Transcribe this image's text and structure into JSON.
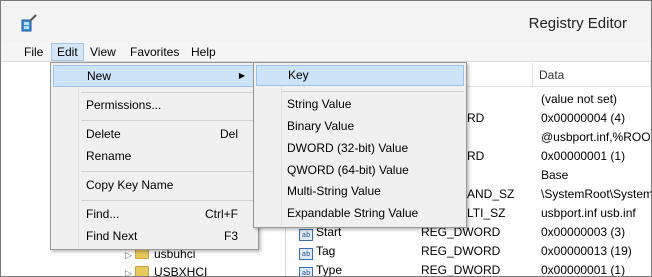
{
  "window": {
    "title": "Registry Editor"
  },
  "menubar": {
    "items": [
      "File",
      "Edit",
      "View",
      "Favorites",
      "Help"
    ]
  },
  "list": {
    "header_data": "Data",
    "rows": [
      {
        "name": "",
        "type": "",
        "data": "(value not set)"
      },
      {
        "name": "",
        "type": "RD",
        "data": "0x00000004 (4)"
      },
      {
        "name": "",
        "type": "",
        "data": "@usbport.inf,%ROOT"
      },
      {
        "name": "",
        "type": "RD",
        "data": "0x00000001 (1)"
      },
      {
        "name": "",
        "type": "",
        "data": "Base"
      },
      {
        "name": "",
        "type": "AND_SZ",
        "data": "\\SystemRoot\\System"
      },
      {
        "name": "",
        "type": "LTI_SZ",
        "data": "usbport.inf usb.inf"
      },
      {
        "name": "Start",
        "type": "REG_DWORD",
        "data": "0x00000003 (3)"
      },
      {
        "name": "Tag",
        "type": "REG_DWORD",
        "data": "0x00000013 (19)"
      },
      {
        "name": "Type",
        "type": "REG_DWORD",
        "data": "0x00000001 (1)"
      }
    ],
    "icon_label": "ab"
  },
  "tree": {
    "items": [
      "usbuhci",
      "USBXHCI"
    ]
  },
  "edit_menu": {
    "new": "New",
    "permissions": "Permissions...",
    "delete": "Delete",
    "delete_shortcut": "Del",
    "rename": "Rename",
    "copy_key_name": "Copy Key Name",
    "find": "Find...",
    "find_shortcut": "Ctrl+F",
    "find_next": "Find Next",
    "find_next_shortcut": "F3"
  },
  "new_submenu": {
    "items": [
      "Key",
      "String Value",
      "Binary Value",
      "DWORD (32-bit) Value",
      "QWORD (64-bit) Value",
      "Multi-String Value",
      "Expandable String Value"
    ]
  },
  "colors": {
    "highlight": "#cde3f8",
    "menu_bg": "#f0f0f0"
  }
}
